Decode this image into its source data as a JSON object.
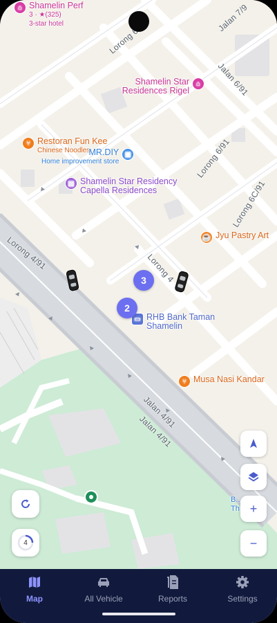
{
  "map": {
    "pois": [
      {
        "name": "Shamelin Perf",
        "sub": "3 · ★(325)",
        "sub2": "3-star hotel"
      },
      {
        "name": "Shamelin Star Residences Rigel"
      },
      {
        "name": "Restoran Fun Kee",
        "sub": "Chinese Noodles"
      },
      {
        "name": "MR.DIY",
        "sub": "Home improvement store"
      },
      {
        "name": "Shamelin Star Residency Capella Residences"
      },
      {
        "name": "Jyu Pastry Art"
      },
      {
        "name": "RHB Bank Taman Shamelin"
      },
      {
        "name": "Musa Nasi Kandar"
      },
      {
        "name": "B... Th..."
      }
    ],
    "streets": [
      "Jalan 7/9",
      "Lorong 6",
      "Jalan 6/91",
      "Lorong 6/91",
      "Lorong 6C/91",
      "Lorong 4/91",
      "Lorong 4",
      "Jalan 4/91",
      "Jalan 4/91"
    ],
    "clusters": [
      "3",
      "2"
    ],
    "controls": {
      "navigate": "▲",
      "layers": "◆",
      "zoom_in": "+",
      "zoom_out": "−",
      "refresh": "↻",
      "timer_count": "4"
    }
  },
  "nav": {
    "items": [
      {
        "label": "Map",
        "icon": "map-icon"
      },
      {
        "label": "All Vehicle",
        "icon": "car-icon"
      },
      {
        "label": "Reports",
        "icon": "document-icon"
      },
      {
        "label": "Settings",
        "icon": "gear-icon"
      }
    ],
    "active": "Map"
  },
  "colors": {
    "nav_bg": "#111a3d",
    "accent": "#8e93ff",
    "cluster": "#6c6ff0",
    "park": "#cfead6"
  }
}
